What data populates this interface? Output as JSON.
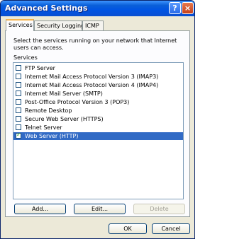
{
  "window": {
    "title": "Advanced Settings",
    "help_glyph": "?",
    "close_glyph": "×"
  },
  "tabs": [
    {
      "label": "Services",
      "active": true
    },
    {
      "label": "Security Logging",
      "active": false
    },
    {
      "label": "ICMP",
      "active": false
    }
  ],
  "panel": {
    "description": "Select the services running on your network that Internet users can access.",
    "list_label": "Services",
    "services": [
      {
        "label": "FTP Server",
        "checked": false
      },
      {
        "label": "Internet Mail Access Protocol Version 3 (IMAP3)",
        "checked": false
      },
      {
        "label": "Internet Mail Access Protocol Version 4 (IMAP4)",
        "checked": false
      },
      {
        "label": "Internet Mail Server (SMTP)",
        "checked": false
      },
      {
        "label": "Post-Office Protocol Version 3 (POP3)",
        "checked": false
      },
      {
        "label": "Remote Desktop",
        "checked": false
      },
      {
        "label": "Secure Web Server (HTTPS)",
        "checked": false
      },
      {
        "label": "Telnet Server",
        "checked": false
      },
      {
        "label": "Web Server (HTTP)",
        "checked": true,
        "selected": true
      }
    ],
    "add_label": "Add...",
    "edit_label": "Edit...",
    "delete_label": "Delete"
  },
  "footer": {
    "ok_label": "OK",
    "cancel_label": "Cancel"
  }
}
